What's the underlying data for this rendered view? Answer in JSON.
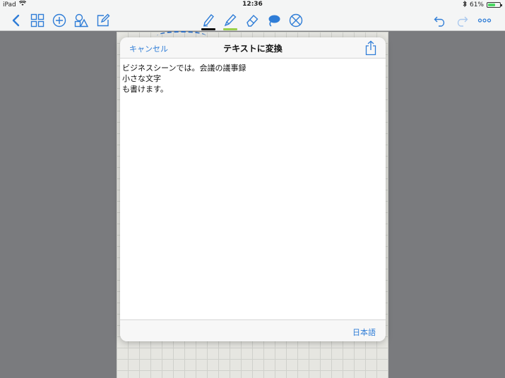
{
  "status_bar": {
    "device": "iPad",
    "time": "12:36",
    "battery_percent": "61%",
    "battery_level": 0.61
  },
  "toolbar": {
    "left_icons": [
      "back-chevron-icon",
      "grid-icon",
      "add-circle-icon",
      "shapes-icon",
      "compose-icon"
    ],
    "tools": [
      "pen-icon",
      "highlighter-icon",
      "eraser-icon",
      "lasso-icon",
      "pointer-disabled-icon"
    ],
    "pen_color": "#111111",
    "highlighter_color": "#9bd14b",
    "right_icons": [
      "undo-icon",
      "redo-icon",
      "more-icon"
    ],
    "accent": "#2f7dd7"
  },
  "dialog": {
    "cancel_label": "キャンセル",
    "title": "テキストに変換",
    "converted_text": "ビジネスシーンでは。会議の議事録\n小さな文字\nも書けます。",
    "language_label": "日本語"
  }
}
